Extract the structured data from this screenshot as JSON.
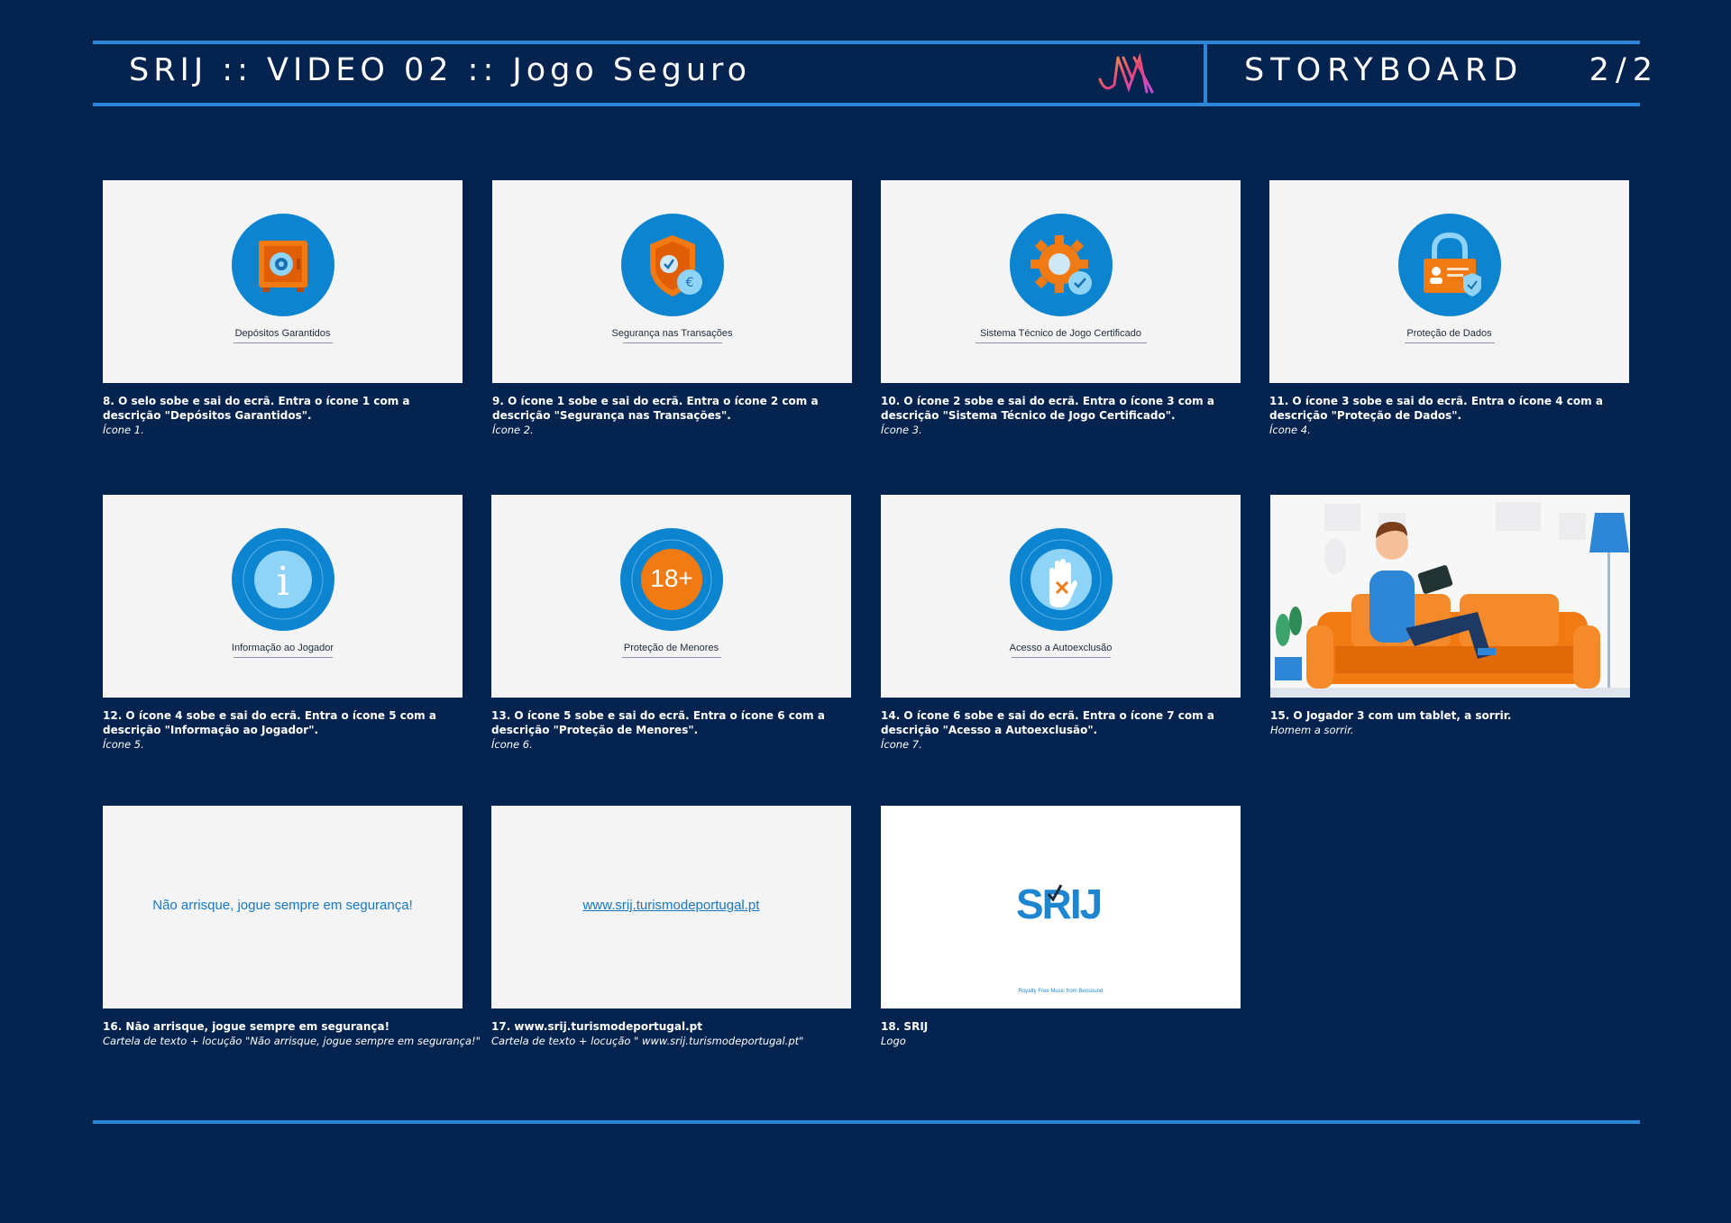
{
  "header": {
    "title": "SRIJ :: VIDEO 02 :: Jogo Seguro",
    "logo": "JM",
    "section": "STORYBOARD",
    "page": "2/2"
  },
  "frames": [
    {
      "label": "Depósitos Garantidos",
      "caption": "8. O selo sobe e sai do ecrã. Entra o ícone 1 com a descrição \"Depósitos Garantidos\".",
      "note": "Ícone 1.",
      "icon": "safe-icon"
    },
    {
      "label": "Segurança nas Transações",
      "caption": "9. O ícone 1 sobe e sai do ecrã. Entra o ícone 2 com a descrição \"Segurança nas Transações\".",
      "note": "Ícone 2.",
      "icon": "shield-euro-icon"
    },
    {
      "label": "Sistema Técnico de Jogo Certificado",
      "caption": "10. O ícone 2 sobe e sai do ecrã. Entra o ícone 3 com a descrição \"Sistema Técnico de Jogo Certificado\".",
      "note": "Ícone 3.",
      "icon": "gear-check-icon"
    },
    {
      "label": "Proteção de Dados",
      "caption": "11. O ícone 3 sobe e sai do ecrã. Entra o ícone 4 com a descrição \"Proteção de Dados\".",
      "note": "Ícone 4.",
      "icon": "lock-id-icon"
    },
    {
      "label": "Informação ao Jogador",
      "caption": "12. O ícone 4 sobe e sai do ecrã. Entra o ícone 5 com a descrição \"Informação ao Jogador\".",
      "note": "Ícone 5.",
      "icon": "info-icon"
    },
    {
      "label": "Proteção de Menores",
      "caption": "13. O ícone 5 sobe e sai do ecrã. Entra o ícone 6 com a descrição \"Proteção de Menores\".",
      "note": "Ícone 6.",
      "icon": "age-18-icon",
      "badge": "18+"
    },
    {
      "label": "Acesso a Autoexclusão",
      "caption": "14. O ícone 6 sobe e sai do ecrã. Entra o ícone 7 com a descrição \"Acesso a Autoexclusão\".",
      "note": "Ícone 7.",
      "icon": "hand-stop-icon"
    },
    {
      "caption": "15. O Jogador 3 com um tablet, a sorrir.",
      "note": "Homem a sorrir.",
      "icon": "man-on-sofa-illustration"
    },
    {
      "text": "Não arrisque, jogue sempre em segurança!",
      "caption": "16. Não arrisque, jogue sempre em segurança!",
      "note": "Cartela de texto + locução \"Não arrisque, jogue sempre em segurança!\""
    },
    {
      "text": "www.srij.turismodeportugal.pt",
      "caption": "17. www.srij.turismodeportugal.pt",
      "note": "Cartela de texto + locução \" www.srij.turismodeportugal.pt\""
    },
    {
      "logo": "SRIJ",
      "royalty": "Royalty Free Music from Bensound",
      "caption": "18. SRIJ",
      "note": "Logo"
    }
  ],
  "colors": {
    "background": "#04234f",
    "accent_line": "#2e86d6",
    "icon_blue": "#0c84d0",
    "icon_orange": "#f27a12",
    "panel_bg": "#f4f4f5"
  }
}
